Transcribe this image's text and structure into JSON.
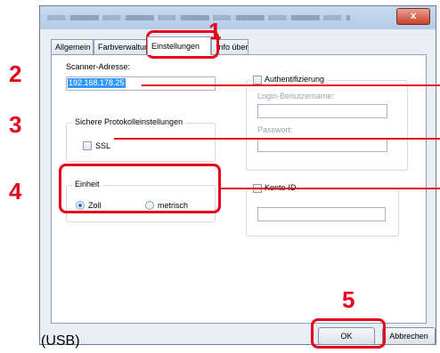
{
  "dialog": {
    "close_glyph": "x",
    "tabs": [
      {
        "label": "Allgemein"
      },
      {
        "label": "Farbverwaltung"
      },
      {
        "label": "Einstellungen"
      },
      {
        "label": "Info über"
      }
    ],
    "scanner": {
      "label": "Scanner-Adresse:",
      "value": "192.168.178.25"
    },
    "protocol": {
      "title": "Sichere Protokolleinstellungen",
      "ssl_label": "SSL",
      "ssl_checked": false
    },
    "unit": {
      "title": "Einheit",
      "options": [
        "Zoll",
        "metrisch"
      ],
      "selected": "Zoll"
    },
    "auth": {
      "label": "Authentifizierung",
      "checked": false,
      "login_label": "Login-Benutzername:",
      "password_label": "Passwort:"
    },
    "konto": {
      "label": "Konto-ID",
      "checked": false
    },
    "buttons": {
      "ok": "OK",
      "cancel": "Abbrechen"
    }
  },
  "annotations": {
    "steps": [
      "1",
      "2",
      "3",
      "4",
      "5"
    ],
    "caption": "(USB)",
    "color": "#e8001b"
  }
}
